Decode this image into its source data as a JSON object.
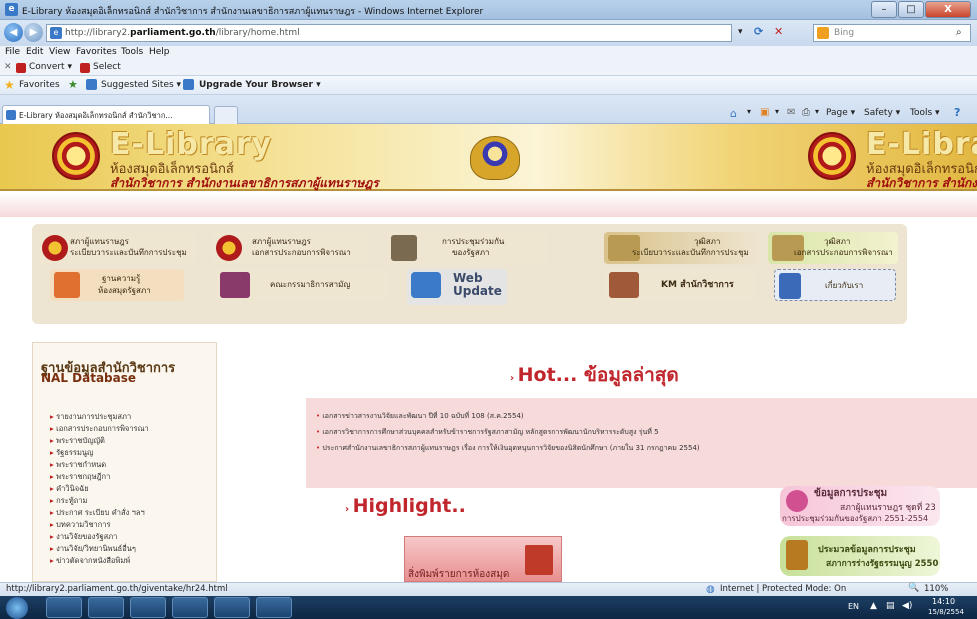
{
  "window": {
    "title": "E-Library ห้องสมุดอิเล็กทรอนิกส์ สำนักวิชาการ สำนักงานเลขาธิการสภาผู้แทนราษฎร - Windows Internet Explorer",
    "minimize": "–",
    "maximize": "□",
    "close": "X"
  },
  "address": {
    "url_prefix": "http://library2.",
    "url_domain": "parliament.go.th",
    "url_path": "/library/home.html",
    "search_placeholder": "Bing"
  },
  "menubar": [
    "File",
    "Edit",
    "View",
    "Favorites",
    "Tools",
    "Help"
  ],
  "convertbar": {
    "convert": "Convert ▾",
    "select": "Select"
  },
  "favbar": {
    "favorites": "Favorites",
    "suggested": "Suggested Sites ▾",
    "upgrade": "Upgrade Your Browser ▾"
  },
  "tabs": {
    "active": "E-Library ห้องสมุดอิเล็กทรอนิกส์ สำนักวิชาก...",
    "toolbar": [
      "Page ▾",
      "Safety ▾",
      "Tools ▾"
    ]
  },
  "banner": {
    "brand": "E-Library",
    "brand_right": "E-Librar",
    "subtitle": "ห้องสมุดอิเล็กทรอนิกส์",
    "subtitle_right": "ห้องสมุดอิเล็กทรอนิกส",
    "org": "สำนักวิชาการ   สำนักงานเลขาธิการสภาผู้แทนราษฎร",
    "org_right": "สำนักวิชาการ   สำนักงาน"
  },
  "menu_tiles": [
    {
      "line1": "สภาผู้แทนราษฎร",
      "line2": "ระเบียบวาระและบันทึกการประชุม"
    },
    {
      "line1": "สภาผู้แทนราษฎร",
      "line2": "เอกสารประกอบการพิจารณา"
    },
    {
      "line1": "การประชุมร่วมกัน",
      "line2": "ของรัฐสภา"
    },
    {
      "line1": "วุฒิสภา",
      "line2": "ระเบียบวาระและบันทึกการประชุม"
    },
    {
      "line1": "วุฒิสภา",
      "line2": "เอกสารประกอบการพิจารณา"
    },
    {
      "line1": "ฐานความรู้",
      "line2": "ห้องสมุดรัฐสภา"
    },
    {
      "line1": "คณะกรรมาธิการสามัญ",
      "line2": ""
    },
    {
      "line1": "Web",
      "line2": "Update"
    },
    {
      "line1": "KM สำนักวิชาการ",
      "line2": ""
    },
    {
      "line1": "เกี่ยวกับเรา",
      "line2": ""
    }
  ],
  "sidebar": {
    "heading_th": "ฐานข้อมูลสำนักวิชาการ",
    "heading_en": "NAL Database",
    "links": [
      "รายงานการประชุมสภา",
      "เอกสารประกอบการพิจารณา",
      "พระราชบัญญัติ",
      "รัฐธรรมนูญ",
      "พระราชกำหนด",
      "พระราชกฤษฎีกา",
      "คำวินิจฉัย",
      "กระทู้ถาม",
      "ประกาศ ระเบียบ คำสั่ง ฯลฯ",
      "บทความวิชาการ",
      "งานวิจัยของรัฐสภา",
      "งานวิจัย/วิทยานิพนธ์อื่นๆ",
      "ข่าวตัดจากหนังสือพิมพ์"
    ]
  },
  "hot": {
    "title": "Hot... ข้อมูลล่าสุด",
    "news": [
      "เอกสารข่าวสารงานวิจัยและพัฒนา ปีที่ 10 ฉบับที่ 108 (ส.ค.2554)",
      "เอกสารวิชาการการศึกษาส่วนบุคคลสำหรับข้าราชการรัฐสภาสามัญ หลักสูตรการพัฒนานักบริหารระดับสูง รุ่นที่ 5",
      "ประกาศสำนักงานเลขาธิการสภาผู้แทนราษฎร เรื่อง การให้เงินอุดหนุนการวิจัยของนิสิตนักศึกษา (ภายใน 31 กรกฎาคม 2554)"
    ]
  },
  "highlight": {
    "title": "Highlight..",
    "caption": "สิ่งพิมพ์รายการห้องสมุด"
  },
  "right_panels": [
    {
      "title": "ข้อมูลการประชุม",
      "line2": "สภาผู้แทนราษฎร ชุดที่ 23",
      "line3": "การประชุมร่วมกันของรัฐสภา 2551-2554"
    },
    {
      "title": "ประมวลข้อมูลการประชุม",
      "line2": "สภาการร่างรัฐธรรมนูญ 2550",
      "line3": ""
    }
  ],
  "statusbar": {
    "link": "http://library2.parliament.go.th/giventake/hr24.html",
    "zone": "Internet | Protected Mode: On",
    "zoom": "110%"
  },
  "taskbar": {
    "lang": "EN",
    "time": "14:10",
    "date": "15/8/2554"
  },
  "colors": {
    "accent_red": "#c0262c",
    "banner_gold": "#e9c84e",
    "hot_bg": "#f7dada"
  }
}
